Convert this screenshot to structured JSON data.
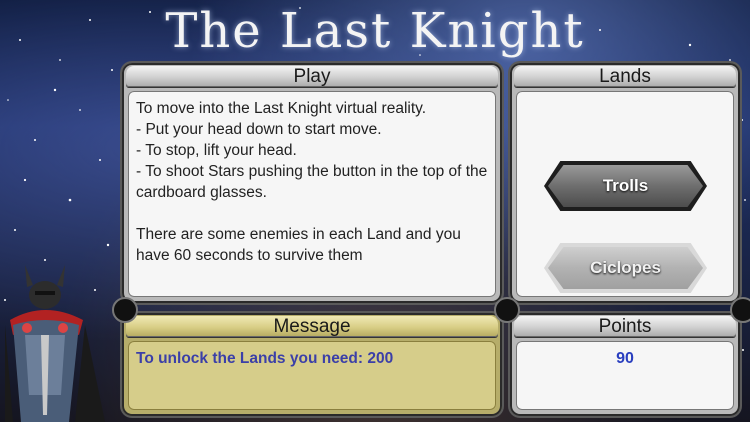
{
  "title": "The Last Knight",
  "play": {
    "header": "Play",
    "lines": [
      "To move into the Last Knight virtual reality.",
      "- Put your head down to start move.",
      "- To stop,  lift your head.",
      "- To shoot Stars pushing the button in the top of the  cardboard glasses."
    ],
    "paragraph2": "There are some enemies in each Land and you have 60 seconds to survive them"
  },
  "lands": {
    "header": "Lands",
    "buttons": [
      {
        "label": "Trolls",
        "state": "enabled"
      },
      {
        "label": "Ciclopes",
        "state": "locked"
      }
    ]
  },
  "message": {
    "header": "Message",
    "text": "To unlock the Lands you need: 200"
  },
  "points": {
    "header": "Points",
    "value": "90"
  },
  "colors": {
    "message_text": "#3b3fa8",
    "points_value": "#2a3fbf",
    "message_panel": "#d6cd8a"
  }
}
